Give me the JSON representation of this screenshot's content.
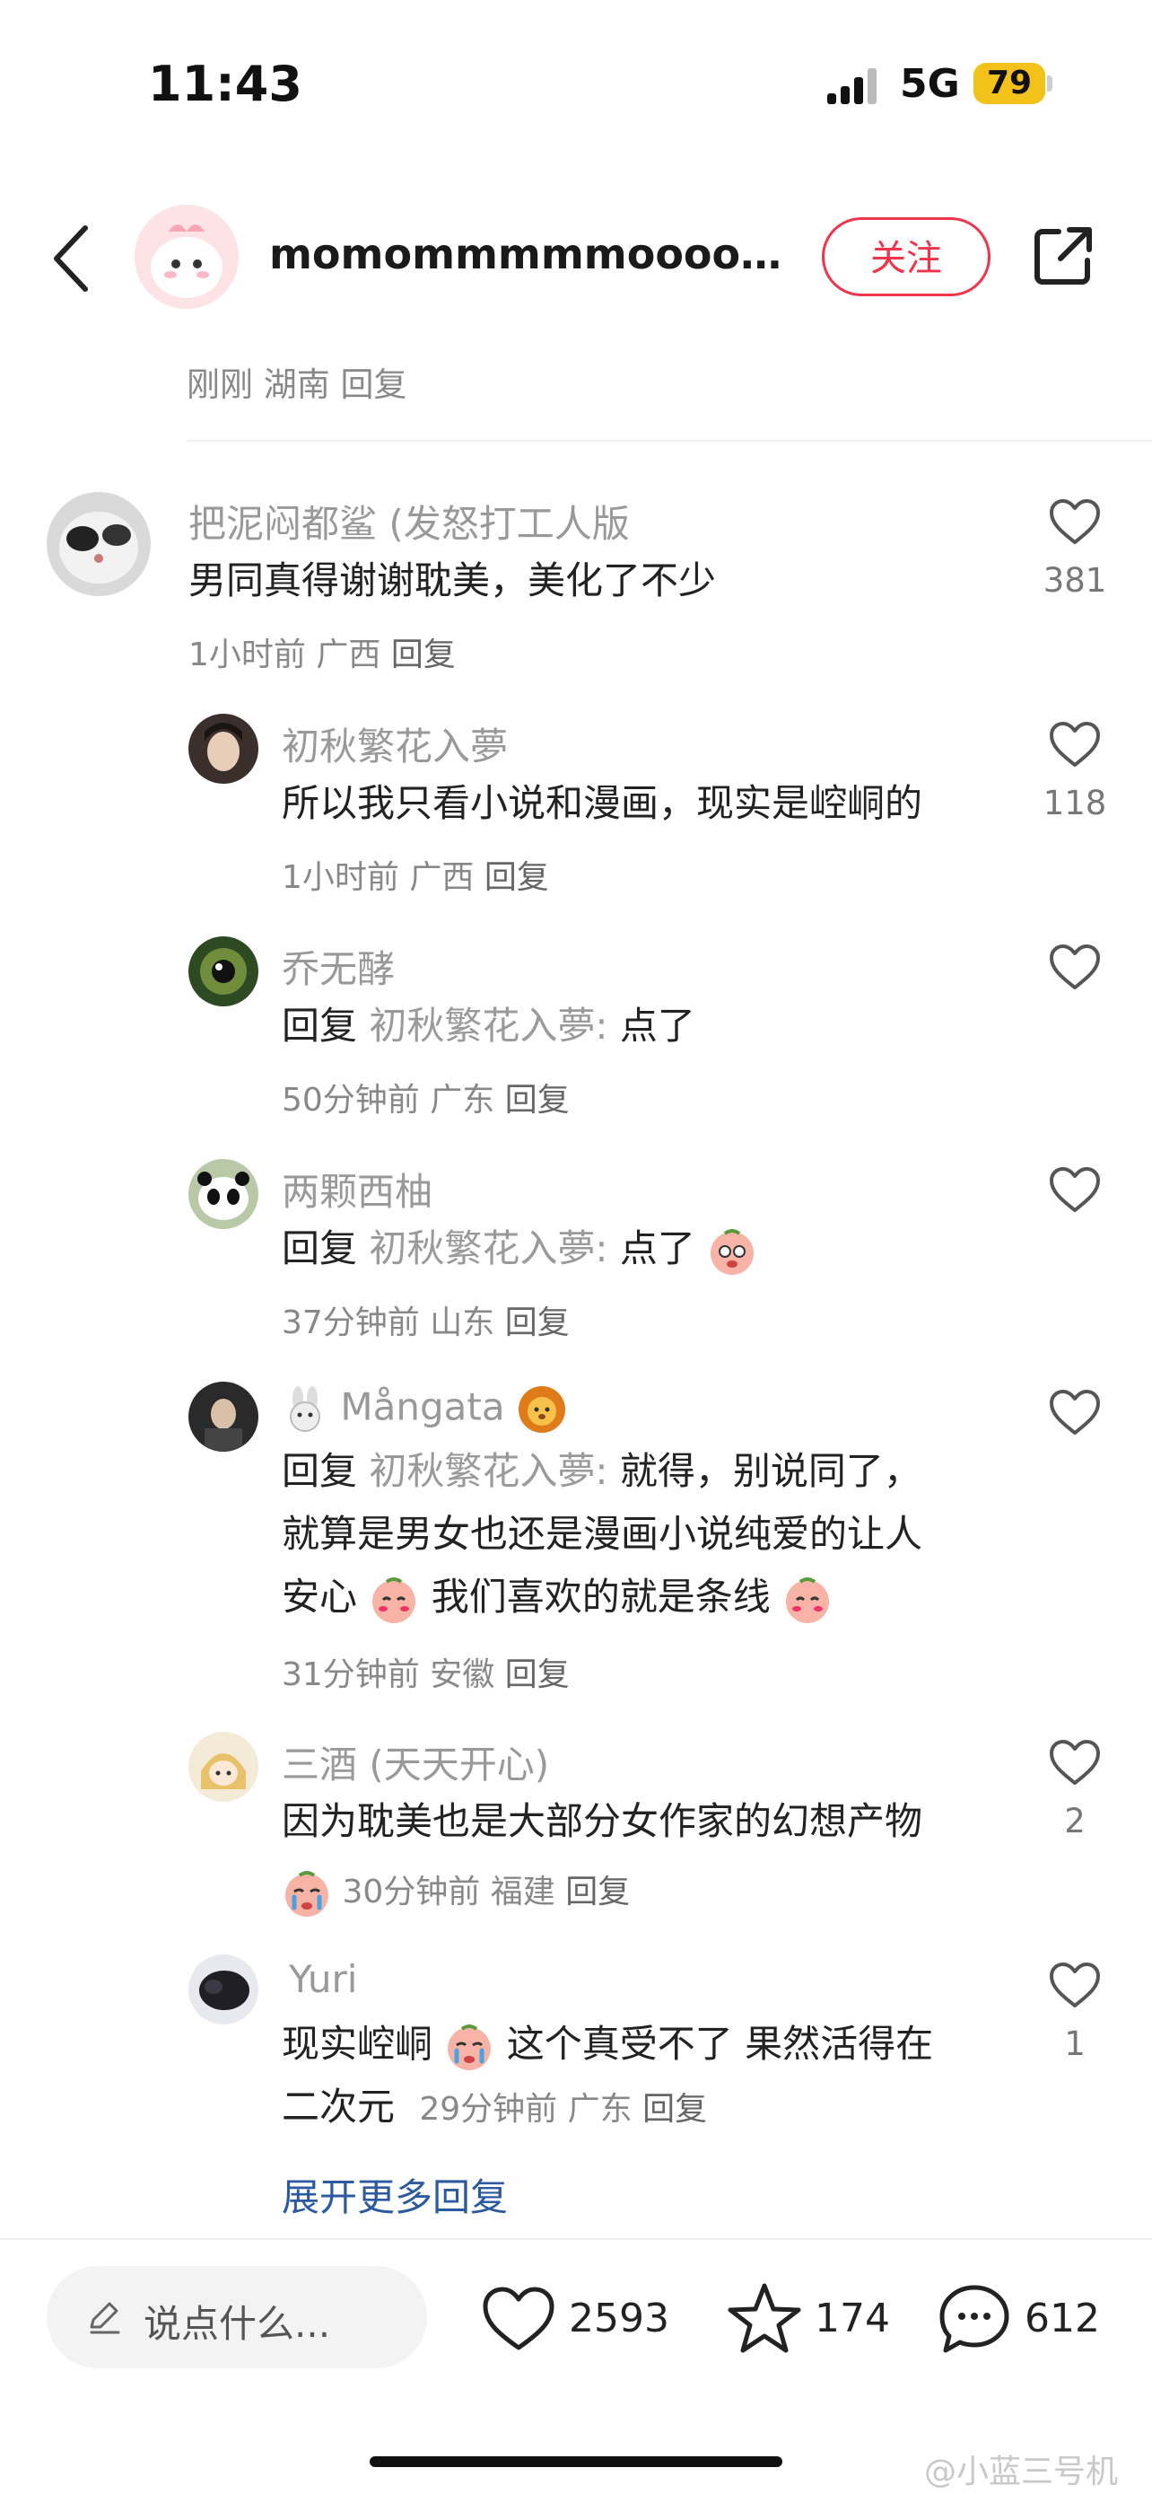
{
  "status_bar": {
    "time": "11:43",
    "network": "5G",
    "battery": "79"
  },
  "header": {
    "username": "momommmmmooooooo...",
    "follow_label": "关注"
  },
  "parent_meta": "刚刚 湖南 回复",
  "comments": [
    {
      "name": "把泥闷都鲨 (发怒打工人版",
      "text": "男同真得谢谢耽美，美化了不少",
      "meta_time": "1小时前",
      "meta_region": "广西",
      "reply_label": "回复",
      "likes": "381"
    },
    {
      "name": "初秋繁花入夢",
      "text": "所以我只看小说和漫画，现实是崆峒的",
      "meta_time": "1小时前",
      "meta_region": "广西",
      "reply_label": "回复",
      "likes": "118"
    },
    {
      "name": "乔无酵",
      "reply_prefix": "回复",
      "reply_to": "初秋繁花入夢:",
      "text": "点了",
      "meta_time": "50分钟前",
      "meta_region": "广东",
      "reply_label": "回复"
    },
    {
      "name": "两颗西柚",
      "reply_prefix": "回复",
      "reply_to": "初秋繁花入夢:",
      "text": "点了",
      "meta_time": "37分钟前",
      "meta_region": "山东",
      "reply_label": "回复"
    },
    {
      "name": "Mångata",
      "reply_prefix": "回复",
      "reply_to": "初秋繁花入夢:",
      "text_a": "就得，别说同了，",
      "text_b": "就算是男女也还是漫画小说纯爱的让人",
      "text_c1": "安心",
      "text_c2": "我们喜欢的就是条线",
      "meta_time": "31分钟前",
      "meta_region": "安徽",
      "reply_label": "回复"
    },
    {
      "name": "三酒 (天天开心)",
      "text": "因为耽美也是大部分女作家的幻想产物",
      "meta_time": "30分钟前",
      "meta_region": "福建",
      "reply_label": "回复",
      "likes": "2"
    },
    {
      "name": "Yuri",
      "text_a1": "现实崆峒",
      "text_a2": "这个真受不了 果然活得在",
      "text_b": "二次元",
      "meta_time": "29分钟前",
      "meta_region": "广东",
      "reply_label": "回复",
      "likes": "1"
    }
  ],
  "expand_label": "展开更多回复",
  "bottom_bar": {
    "input_placeholder": "说点什么...",
    "like_count": "2593",
    "star_count": "174",
    "comment_count": "612"
  },
  "watermark": "@小蓝三号机",
  "icons": [
    "back-icon",
    "share-icon",
    "heart-icon",
    "star-icon",
    "chat-icon",
    "pencil-icon",
    "weibo-icon"
  ],
  "colors": {
    "accent": "#f0344b",
    "link": "#2c5aa0",
    "battery": "#f3c21a"
  }
}
